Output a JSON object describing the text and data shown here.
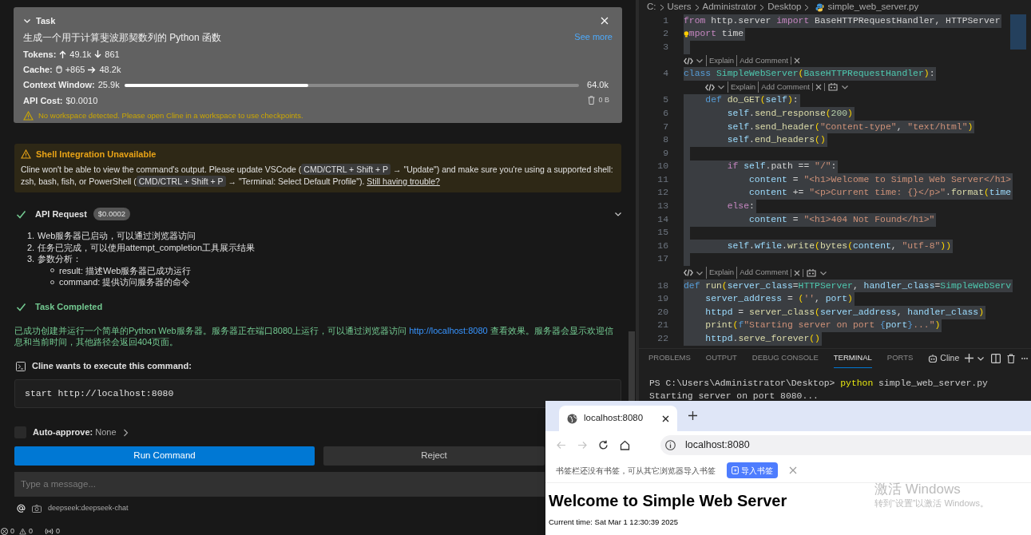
{
  "task": {
    "title": "Task",
    "prompt": "生成一个用于计算斐波那契数列的 Python 函数",
    "see_more": "See more",
    "tokens": {
      "label": "Tokens:",
      "up": "49.1k",
      "down": "861"
    },
    "cache": {
      "label": "Cache:",
      "writes": "+865",
      "reads": "48.2k"
    },
    "context_window": {
      "label": "Context Window:",
      "used": "25.9k",
      "level": 0.405,
      "max": "64.0k"
    },
    "api_cost": {
      "label": "API Cost:",
      "value": "$0.0010"
    },
    "storage": "0 B",
    "warning": "No workspace detected. Please open Cline in a workspace to use checkpoints."
  },
  "shell_warning": {
    "title": "Shell Integration Unavailable",
    "message": [
      {
        "kind": "text",
        "text": "Cline won't be able to view the command's output. Please update VSCode ("
      },
      {
        "kind": "kbd",
        "text": "CMD/CTRL + Shift + P"
      },
      {
        "kind": "text",
        "text": " → \"Update\") and make sure you're using a supported shell: zsh, bash, fish, or PowerShell ("
      },
      {
        "kind": "kbd",
        "text": "CMD/CTRL + Shift + P"
      },
      {
        "kind": "text",
        "text": " → \"Terminal: Select Default Profile\"). "
      },
      {
        "kind": "link",
        "text": "Still having trouble?"
      }
    ]
  },
  "api_request": {
    "label": "API Request",
    "cost": "$0.0002",
    "expanded": false,
    "items": [
      {
        "number": "1.",
        "text": "Web服务器已启动，可以通过浏览器访问"
      },
      {
        "number": "2.",
        "text": "任务已完成，可以使用attempt_completion工具展示结果"
      },
      {
        "number": "3.",
        "text": "参数分析：",
        "children": [
          {
            "text": "result: 描述Web服务器已成功运行"
          },
          {
            "text": "command: 提供访问服务器的命令"
          }
        ]
      }
    ]
  },
  "task_completed": {
    "label": "Task Completed",
    "message": [
      {
        "kind": "text",
        "text": "已成功创建并运行一个简单的Python Web服务器。服务器正在端口8080上运行，可以通过浏览器访问 "
      },
      {
        "kind": "link",
        "text": "http://localhost:8080"
      },
      {
        "kind": "text",
        "text": " 查看效果。服务器会显示欢迎信息和当前时间，其他路径会返回404页面。"
      }
    ]
  },
  "command": {
    "label": "Cline wants to execute this command:",
    "command": "start http://localhost:8080"
  },
  "auto_approve": {
    "checked": false,
    "label": "Auto-approve:",
    "value": "None"
  },
  "buttons": [
    {
      "label": "Run Command",
      "kind": "primary"
    },
    {
      "label": "Reject",
      "kind": "secondary"
    }
  ],
  "message_input": {
    "placeholder": "Type a message..."
  },
  "model": "deepseek:deepseek-chat",
  "status_bar": {
    "errors": "0",
    "warnings": "0",
    "ports": "0"
  },
  "editor": {
    "breadcrumb": [
      "C:",
      "Users",
      "Administrator",
      "Desktop",
      "simple_web_server.py"
    ],
    "lines": [
      {
        "kind": "code",
        "number": "1",
        "tokens": [
          {
            "kind": "keyword",
            "text": "from"
          },
          {
            "kind": "plain",
            "text": " http.server "
          },
          {
            "kind": "keyword",
            "text": "import"
          },
          {
            "kind": "plain",
            "text": " BaseHTTPRequestHandler, HTTPServer"
          }
        ]
      },
      {
        "kind": "code",
        "number": "2",
        "lightbulb": true,
        "tokens": [
          {
            "kind": "keyword",
            "text": "mport"
          },
          {
            "kind": "plain",
            "text": " time"
          }
        ]
      },
      {
        "kind": "code",
        "number": "3"
      },
      {
        "kind": "lens",
        "actions": [
          "Explain",
          "Add Comment"
        ],
        "ai": false
      },
      {
        "kind": "code",
        "number": "4",
        "tokens": [
          {
            "kind": "decl",
            "text": "class"
          },
          {
            "kind": "type",
            "text": " SimpleWebServer"
          },
          {
            "kind": "paren",
            "text": "("
          },
          {
            "kind": "type",
            "text": "BaseHTTPRequestHandler"
          },
          {
            "kind": "paren",
            "text": ")"
          },
          {
            "kind": "plain",
            "text": ":"
          }
        ]
      },
      {
        "kind": "lens_indented",
        "actions": [
          "Explain",
          "Add Comment"
        ],
        "ai": true
      },
      {
        "kind": "code",
        "number": "5",
        "tokens": [
          {
            "kind": "decl",
            "text": "    def"
          },
          {
            "kind": "func",
            "text": " do_GET"
          },
          {
            "kind": "paren",
            "text": "("
          },
          {
            "kind": "var",
            "text": "self"
          },
          {
            "kind": "paren",
            "text": ")"
          },
          {
            "kind": "plain",
            "text": ":"
          }
        ]
      },
      {
        "kind": "code",
        "number": "6",
        "tokens": [
          {
            "kind": "var",
            "text": "        self"
          },
          {
            "kind": "plain",
            "text": "."
          },
          {
            "kind": "func",
            "text": "send_response"
          },
          {
            "kind": "paren",
            "text": "("
          },
          {
            "kind": "num",
            "text": "200"
          },
          {
            "kind": "paren",
            "text": ")"
          }
        ]
      },
      {
        "kind": "code",
        "number": "7",
        "tokens": [
          {
            "kind": "var",
            "text": "        self"
          },
          {
            "kind": "plain",
            "text": "."
          },
          {
            "kind": "func",
            "text": "send_header"
          },
          {
            "kind": "paren",
            "text": "("
          },
          {
            "kind": "str",
            "text": "\"Content-type\""
          },
          {
            "kind": "plain",
            "text": ", "
          },
          {
            "kind": "str",
            "text": "\"text/html\""
          },
          {
            "kind": "paren",
            "text": ")"
          }
        ]
      },
      {
        "kind": "code",
        "number": "8",
        "tokens": [
          {
            "kind": "var",
            "text": "        self"
          },
          {
            "kind": "plain",
            "text": "."
          },
          {
            "kind": "func",
            "text": "end_headers"
          },
          {
            "kind": "paren",
            "text": "()"
          }
        ]
      },
      {
        "kind": "code",
        "number": "9"
      },
      {
        "kind": "code",
        "number": "10",
        "tokens": [
          {
            "kind": "keyword",
            "text": "        if"
          },
          {
            "kind": "var",
            "text": " self"
          },
          {
            "kind": "plain",
            "text": ".path == "
          },
          {
            "kind": "str",
            "text": "\"/\""
          },
          {
            "kind": "plain",
            "text": ":"
          }
        ]
      },
      {
        "kind": "code",
        "number": "11",
        "tokens": [
          {
            "kind": "var",
            "text": "            content"
          },
          {
            "kind": "plain",
            "text": " = "
          },
          {
            "kind": "str",
            "text": "\"<h1>Welcome to Simple Web Server</h1>"
          }
        ]
      },
      {
        "kind": "code",
        "number": "12",
        "tokens": [
          {
            "kind": "var",
            "text": "            content"
          },
          {
            "kind": "plain",
            "text": " += "
          },
          {
            "kind": "str",
            "text": "\"<p>Current time: {}</p>\""
          },
          {
            "kind": "plain",
            "text": "."
          },
          {
            "kind": "func",
            "text": "format"
          },
          {
            "kind": "paren",
            "text": "("
          },
          {
            "kind": "var",
            "text": "time"
          }
        ]
      },
      {
        "kind": "code",
        "number": "13",
        "tokens": [
          {
            "kind": "keyword",
            "text": "        else"
          },
          {
            "kind": "plain",
            "text": ":"
          }
        ]
      },
      {
        "kind": "code",
        "number": "14",
        "tokens": [
          {
            "kind": "var",
            "text": "            content"
          },
          {
            "kind": "plain",
            "text": " = "
          },
          {
            "kind": "str",
            "text": "\"<h1>404 Not Found</h1>\""
          }
        ]
      },
      {
        "kind": "code",
        "number": "15"
      },
      {
        "kind": "code",
        "number": "16",
        "tokens": [
          {
            "kind": "var",
            "text": "        self"
          },
          {
            "kind": "plain",
            "text": "."
          },
          {
            "kind": "var",
            "text": "wfile"
          },
          {
            "kind": "plain",
            "text": "."
          },
          {
            "kind": "func",
            "text": "write"
          },
          {
            "kind": "paren",
            "text": "("
          },
          {
            "kind": "func",
            "text": "bytes"
          },
          {
            "kind": "paren",
            "text": "("
          },
          {
            "kind": "var",
            "text": "content"
          },
          {
            "kind": "plain",
            "text": ", "
          },
          {
            "kind": "str",
            "text": "\"utf-8\""
          },
          {
            "kind": "paren",
            "text": "))"
          }
        ]
      },
      {
        "kind": "code",
        "number": "17"
      },
      {
        "kind": "lens",
        "actions": [
          "Explain",
          "Add Comment"
        ],
        "ai": true
      },
      {
        "kind": "code",
        "number": "18",
        "tokens": [
          {
            "kind": "decl",
            "text": "def"
          },
          {
            "kind": "func",
            "text": " run"
          },
          {
            "kind": "paren",
            "text": "("
          },
          {
            "kind": "var",
            "text": "server_class"
          },
          {
            "kind": "plain",
            "text": "="
          },
          {
            "kind": "type",
            "text": "HTTPServer"
          },
          {
            "kind": "plain",
            "text": ", "
          },
          {
            "kind": "var",
            "text": "handler_class"
          },
          {
            "kind": "plain",
            "text": "="
          },
          {
            "kind": "type",
            "text": "SimpleWebServ"
          }
        ]
      },
      {
        "kind": "code",
        "number": "19",
        "tokens": [
          {
            "kind": "var",
            "text": "    server_address"
          },
          {
            "kind": "plain",
            "text": " = "
          },
          {
            "kind": "paren",
            "text": "("
          },
          {
            "kind": "str",
            "text": "''"
          },
          {
            "kind": "plain",
            "text": ", "
          },
          {
            "kind": "var",
            "text": "port"
          },
          {
            "kind": "paren",
            "text": ")"
          }
        ]
      },
      {
        "kind": "code",
        "number": "20",
        "tokens": [
          {
            "kind": "var",
            "text": "    httpd"
          },
          {
            "kind": "plain",
            "text": " = "
          },
          {
            "kind": "func",
            "text": "server_class"
          },
          {
            "kind": "paren",
            "text": "("
          },
          {
            "kind": "var",
            "text": "server_address"
          },
          {
            "kind": "plain",
            "text": ", "
          },
          {
            "kind": "var",
            "text": "handler_class"
          },
          {
            "kind": "paren",
            "text": ")"
          }
        ]
      },
      {
        "kind": "code",
        "number": "21",
        "tokens": [
          {
            "kind": "func",
            "text": "    print"
          },
          {
            "kind": "paren",
            "text": "("
          },
          {
            "kind": "decl",
            "text": "f"
          },
          {
            "kind": "str",
            "text": "\"Starting server on port "
          },
          {
            "kind": "decl",
            "text": "{"
          },
          {
            "kind": "var",
            "text": "port"
          },
          {
            "kind": "decl",
            "text": "}"
          },
          {
            "kind": "str",
            "text": "...\""
          },
          {
            "kind": "paren",
            "text": ")"
          }
        ]
      },
      {
        "kind": "code",
        "number": "22",
        "tokens": [
          {
            "kind": "var",
            "text": "    httpd"
          },
          {
            "kind": "plain",
            "text": "."
          },
          {
            "kind": "func",
            "text": "serve_forever"
          },
          {
            "kind": "paren",
            "text": "()"
          }
        ]
      }
    ]
  },
  "panel": {
    "tabs": [
      {
        "label": "PROBLEMS",
        "selected": false
      },
      {
        "label": "OUTPUT",
        "selected": false
      },
      {
        "label": "DEBUG CONSOLE",
        "selected": false
      },
      {
        "label": "TERMINAL",
        "selected": true
      },
      {
        "label": "PORTS",
        "selected": false
      }
    ],
    "terminal_profile": "Cline",
    "terminal": [
      [
        {
          "kind": "plain",
          "text": "PS C:\\Users\\Administrator\\Desktop> "
        },
        {
          "kind": "command",
          "text": "python"
        },
        {
          "kind": "plain",
          "text": " simple_web_server.py"
        }
      ],
      [
        {
          "kind": "plain",
          "text": "Starting server on port 8080..."
        }
      ]
    ]
  },
  "browser": {
    "tab_title": "localhost:8080",
    "address": "localhost:8080",
    "bookmark_hint": "书签栏还没有书签，可从其它浏览器导入书签",
    "import_button": "导入书签",
    "heading": "Welcome to Simple Web Server",
    "time": "Current time: Sat Mar 1 12:30:39 2025"
  },
  "windows_activation": {
    "title": "激活 Windows",
    "subtitle": "转到“设置”以激活 Windows。"
  }
}
